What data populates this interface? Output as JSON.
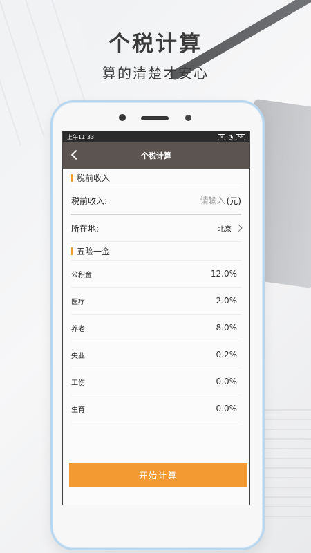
{
  "hero": {
    "title": "个税计算",
    "subtitle": "算的清楚才安心"
  },
  "status_bar": {
    "time": "上午11:33",
    "icons": [
      "sim-icon",
      "wifi-icon",
      "battery-icon"
    ],
    "battery": "56"
  },
  "nav": {
    "title": "个税计算",
    "back_icon": "chevron-left-icon"
  },
  "income_section": {
    "header": "税前收入",
    "field_label": "税前收入:",
    "placeholder": "请输入",
    "unit": "(元)"
  },
  "location": {
    "label": "所在地:",
    "value": "北京"
  },
  "insurance_section": {
    "header": "五险一金",
    "items": [
      {
        "label": "公积金",
        "value": "12.0%"
      },
      {
        "label": "医疗",
        "value": "2.0%"
      },
      {
        "label": "养老",
        "value": "8.0%"
      },
      {
        "label": "失业",
        "value": "0.2%"
      },
      {
        "label": "工伤",
        "value": "0.0%"
      },
      {
        "label": "生育",
        "value": "0.0%"
      }
    ]
  },
  "action": {
    "start_label": "开始计算"
  },
  "colors": {
    "accent": "#f49a33",
    "navbar": "#5b5451",
    "phone_frame": "#b9d6ef"
  }
}
